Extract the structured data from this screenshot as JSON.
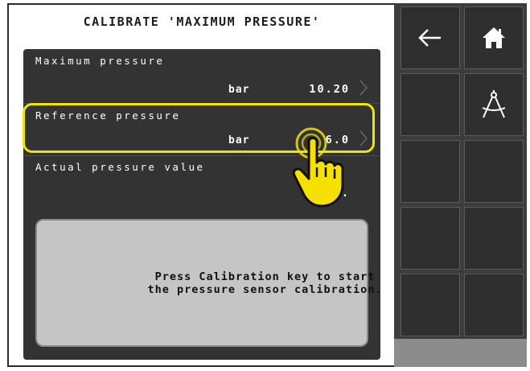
{
  "title": "CALIBRATE 'MAXIMUM PRESSURE'",
  "rows": [
    {
      "label": "Maximum pressure",
      "unit": "bar",
      "value": "10.20"
    },
    {
      "label": "Reference pressure",
      "unit": "bar",
      "value": "6.0"
    },
    {
      "label": "Actual pressure value",
      "unit": "",
      "value": "2."
    }
  ],
  "message_lines": [
    "Press Calibration key to start",
    "the pressure sensor calibration."
  ],
  "softkeys": {
    "back_icon": "arrow-left-icon",
    "home_icon": "home-icon",
    "calibrate_icon": "compass-icon"
  },
  "colors": {
    "panel": "#333333",
    "highlight": "#f2e600",
    "hand": "#f5e000",
    "message_bg": "#c5c5c5"
  }
}
